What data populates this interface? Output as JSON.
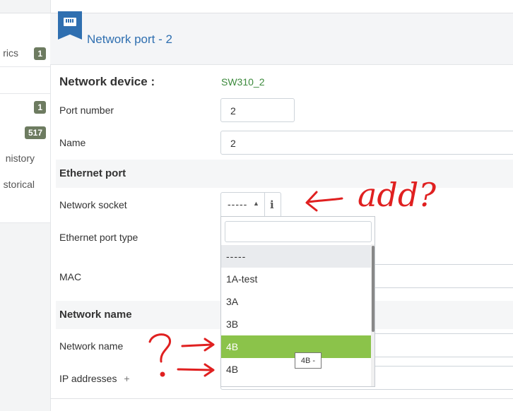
{
  "sidebar": {
    "items": [
      {
        "label": "rics",
        "badge": "1"
      },
      {
        "label": "",
        "badge": ""
      },
      {
        "label": "",
        "badge": "1"
      },
      {
        "label": "",
        "badge": "517"
      },
      {
        "label": "nistory",
        "badge": ""
      },
      {
        "label": "storical",
        "badge": ""
      }
    ]
  },
  "header": {
    "title": "Network port - 2",
    "icon": "network-port-icon"
  },
  "form": {
    "device_label": "Network device :",
    "device_value": "SW310_2",
    "port_number_label": "Port number",
    "port_number_value": "2",
    "name_label": "Name",
    "name_value": "2",
    "ethernet_section": "Ethernet port",
    "network_socket_label": "Network socket",
    "network_socket_value": "-----",
    "ethernet_type_label": "Ethernet port type",
    "mac_label": "MAC",
    "network_name_section": "Network name",
    "network_name_label": "Network name",
    "ip_addresses_label": "IP addresses",
    "ip_add_symbol": "+"
  },
  "dropdown": {
    "options": [
      "-----",
      "1A-test",
      "3A",
      "3B",
      "4B",
      "4B"
    ],
    "highlighted_index": 4,
    "tooltip": "4B -"
  },
  "annotations": {
    "text": "add?",
    "question": "?",
    "color": "#e02020"
  },
  "colors": {
    "accent": "#2f6fb0",
    "badge": "#6d7b60",
    "highlight": "#8bc34a",
    "link_green": "#3c8a3c"
  }
}
